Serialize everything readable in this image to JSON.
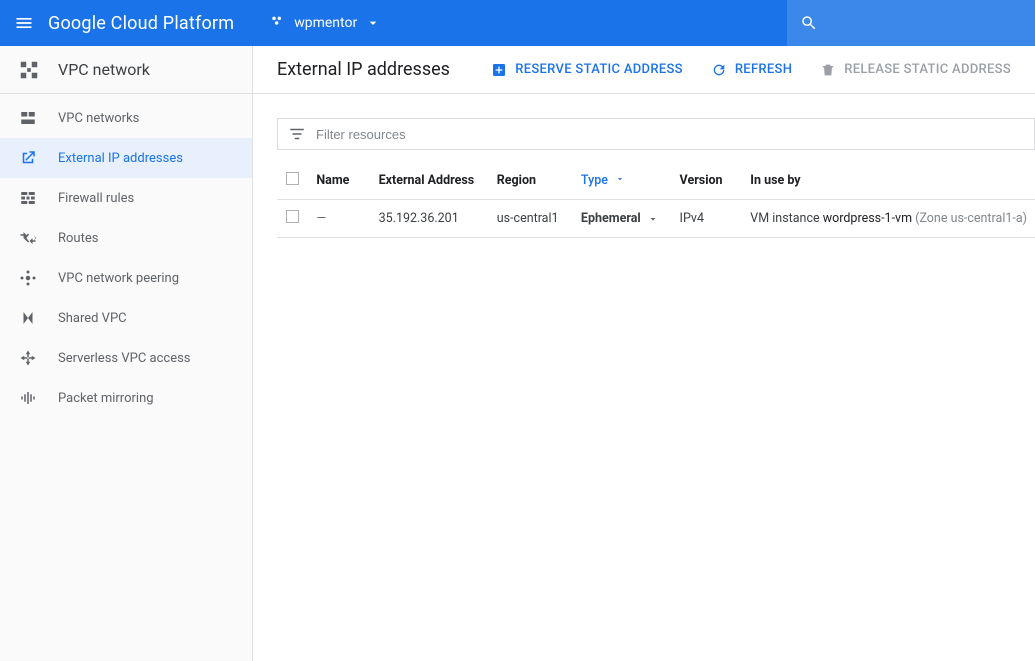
{
  "topbar": {
    "platform": "Google Cloud Platform",
    "project": "wpmentor",
    "search_placeholder": ""
  },
  "sidebar": {
    "section_title": "VPC network",
    "items": [
      {
        "label": "VPC networks"
      },
      {
        "label": "External IP addresses"
      },
      {
        "label": "Firewall rules"
      },
      {
        "label": "Routes"
      },
      {
        "label": "VPC network peering"
      },
      {
        "label": "Shared VPC"
      },
      {
        "label": "Serverless VPC access"
      },
      {
        "label": "Packet mirroring"
      }
    ],
    "active_index": 1
  },
  "page": {
    "title": "External IP addresses",
    "actions": {
      "reserve": "RESERVE STATIC ADDRESS",
      "refresh": "REFRESH",
      "release": "RELEASE STATIC ADDRESS"
    }
  },
  "filter": {
    "placeholder": "Filter resources"
  },
  "table": {
    "columns": {
      "name": "Name",
      "external_address": "External Address",
      "region": "Region",
      "type": "Type",
      "version": "Version",
      "in_use_by": "In use by"
    },
    "sort_column": "type",
    "rows": [
      {
        "name": "—",
        "external_address": "35.192.36.201",
        "region": "us-central1",
        "type": "Ephemeral",
        "version": "IPv4",
        "in_use_prefix": "VM instance ",
        "in_use_target": "wordpress-1-vm",
        "in_use_suffix": " (Zone us-central1-a)"
      }
    ]
  }
}
